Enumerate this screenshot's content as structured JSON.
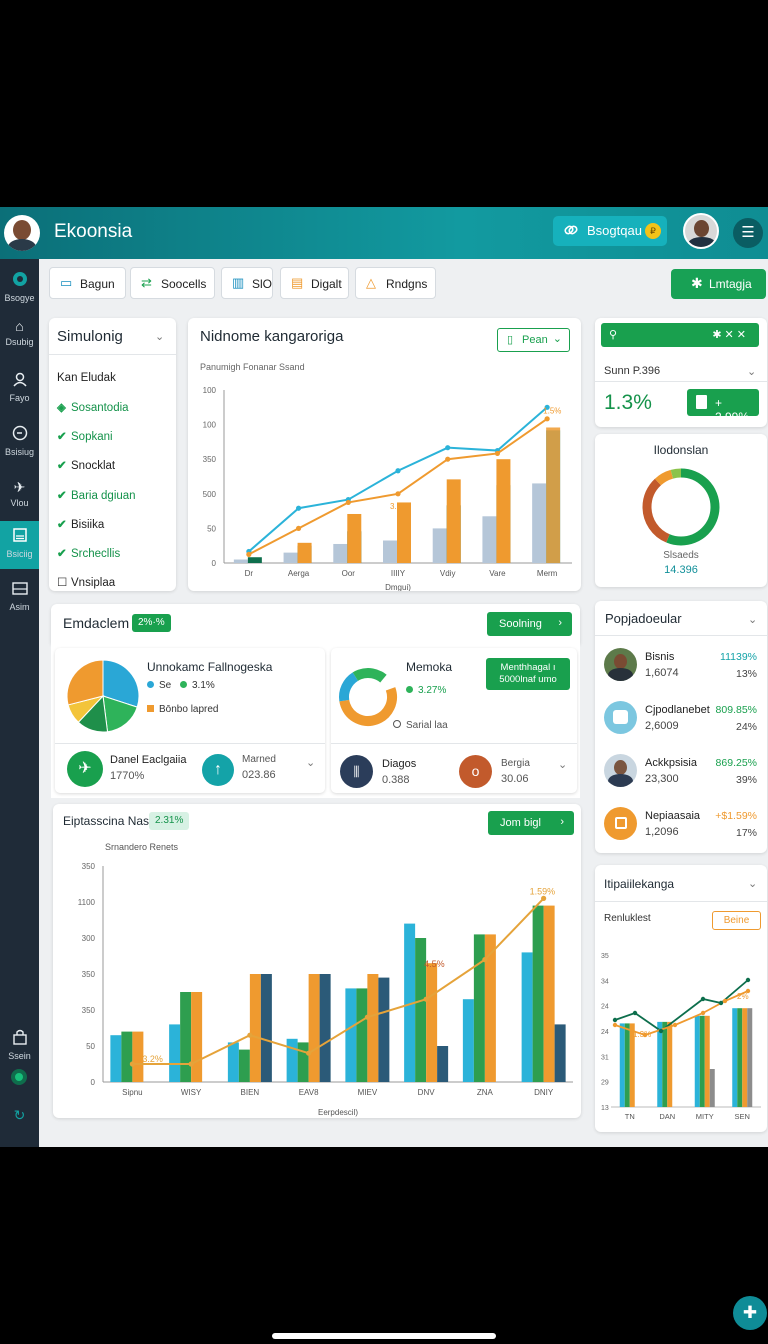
{
  "app": {
    "title": "Ekoonsia"
  },
  "header": {
    "badge_label": "Bsogtqau",
    "coin": "₽",
    "menu_icon": "menu-icon"
  },
  "colors": {
    "primary": "#19a04e",
    "teal": "#129aa0",
    "sidebar": "#1f2b38",
    "orange": "#ef9a2f",
    "blue": "#2bb3d9"
  },
  "sidebar": {
    "items": [
      {
        "label": "Bsogye",
        "icon": "logo-icon"
      },
      {
        "label": "Dsubig",
        "icon": "home-icon"
      },
      {
        "label": "Fayo",
        "icon": "user-icon"
      },
      {
        "label": "Bsisiug",
        "icon": "clock-icon"
      },
      {
        "label": "Vlou",
        "icon": "plane-icon"
      },
      {
        "label": "Bsiciig",
        "icon": "report-icon"
      },
      {
        "label": "Asim",
        "icon": "window-icon"
      }
    ],
    "bottom_item": {
      "label": "Ssein",
      "icon": "lock-icon"
    }
  },
  "toolbar": {
    "buttons": [
      {
        "label": "Bagun"
      },
      {
        "label": "Soocells"
      },
      {
        "label": "SlO"
      },
      {
        "label": "Digalt"
      },
      {
        "label": "Rndgns"
      }
    ],
    "primary_label": "Lmtagja"
  },
  "filters": {
    "title": "Simulonig",
    "heading": "Kan Eludak",
    "items": [
      {
        "label": "Sosantodia",
        "checked": true,
        "green": true
      },
      {
        "label": "Sopkani",
        "checked": true,
        "green": true
      },
      {
        "label": "Snocklat",
        "checked": true,
        "green": false
      },
      {
        "label": "Baria dgiuan",
        "checked": true,
        "green": true
      },
      {
        "label": "Bisiika",
        "checked": true,
        "green": false
      },
      {
        "label": "Srchecllis",
        "checked": true,
        "green": true
      },
      {
        "label": "Vnsiplaa",
        "checked": false,
        "green": false
      }
    ]
  },
  "main_chart": {
    "title": "Nidnome kangaroriga",
    "subtitle": "Panumigh  Fonanar Ssand",
    "period_label": "Pean"
  },
  "summary": {
    "label": "Sunn P.396",
    "value": "1.3%",
    "badge": "+ 2.99%"
  },
  "donut": {
    "title": "Ilodonslan",
    "label": "Slsaeds",
    "value": "14.396"
  },
  "section": {
    "title": "Emdaclem",
    "pill": "2%·%",
    "button_label": "Soolning"
  },
  "pie_card": {
    "title": "Unnokamc Fallnogeska",
    "legend": [
      {
        "label": "Se",
        "color": "#2aa7d6"
      },
      {
        "label": "3.1%",
        "color": "#2eb35a"
      },
      {
        "label": "Bōnbo lapred",
        "color": "#ef9a2f"
      }
    ],
    "metrics": [
      {
        "label": "Danel Eaclgaiia",
        "value": "1770%",
        "icon": "plane-icon",
        "color": "#19a04e"
      },
      {
        "label": "Marned",
        "value": "023.86",
        "icon": "arrow-up-icon",
        "color": "#14a3a8"
      }
    ]
  },
  "donut2_card": {
    "title": "Memoka",
    "legend_value": "3.27%",
    "tag": "Menthhagal ı 5000lnaf umo",
    "footnote": "Sarial laa",
    "metrics": [
      {
        "label": "Diagos",
        "value": "0.388",
        "icon": "bars-icon",
        "color": "#2b3d5a"
      },
      {
        "label": "Bergia",
        "value": "30.06",
        "icon": "circle-icon",
        "color": "#c25a2c"
      }
    ]
  },
  "bottom_chart": {
    "title": "Eiptasscina Nas",
    "pill": "2.31%",
    "button_label": "Jom bigl",
    "subtitle": "Srnandero Renets"
  },
  "people": {
    "title": "Popjadoeular",
    "items": [
      {
        "name": "Bisnis",
        "sub": "1,6074",
        "pct": "11139%",
        "pct2": "13%",
        "pct_color": "#14a3a8"
      },
      {
        "name": "Cjpodlanebet",
        "sub": "2,6009",
        "pct": "809.85%",
        "pct2": "24%",
        "pct_color": "#19a04e"
      },
      {
        "name": "Ackkpsisia",
        "sub": "23,300",
        "pct": "869.25%",
        "pct2": "39%",
        "pct_color": "#19a04e"
      },
      {
        "name": "Nepiaasaia",
        "sub": "1,2096",
        "pct": "+$1.59%",
        "pct2": "17%",
        "pct_color": "#ef9a2f"
      }
    ]
  },
  "small_chart": {
    "title": "Itipaiilekanga",
    "subtitle": "Renluklest",
    "button_label": "Beine"
  },
  "chart_data": [
    {
      "type": "bar",
      "title": "Nidnome kangaroriga",
      "xlabel": "Dmgui)",
      "categories": [
        "Dr",
        "Aerga",
        "Oor",
        "IIIIY",
        "Vdiy",
        "Vare",
        "Merm"
      ],
      "y_ticks": [
        "0",
        "50",
        "500",
        "350",
        "100",
        "100"
      ],
      "ylim": [
        0,
        6
      ],
      "series": [
        {
          "values": [
            0.2,
            0.6,
            1.1,
            1.3,
            2.0,
            2.7,
            4.6
          ],
          "color_light": "#b5c6d8",
          "color_dark": "#0d6e4c"
        },
        {
          "values": [
            0.0,
            0.7,
            1.7,
            2.1,
            2.9,
            3.6,
            4.7
          ],
          "color": "#ef9a2f"
        }
      ],
      "lines": [
        {
          "values": [
            0.4,
            1.9,
            2.2,
            3.2,
            4.0,
            3.9,
            5.4
          ],
          "color": "#2bb3d9"
        },
        {
          "values": [
            0.3,
            1.2,
            2.1,
            2.4,
            3.6,
            3.8,
            5.0
          ],
          "color": "#ef9a2f"
        }
      ],
      "annotations": [
        {
          "text": "1.5%"
        },
        {
          "text": "3.1%"
        }
      ]
    },
    {
      "type": "pie",
      "slices": [
        {
          "value": 30,
          "color": "#2aa7d6"
        },
        {
          "value": 18,
          "color": "#2eb35a"
        },
        {
          "value": 14,
          "color": "#1f8f4a"
        },
        {
          "value": 9,
          "color": "#f3c43a"
        },
        {
          "value": 29,
          "color": "#ef9a2f"
        }
      ]
    },
    {
      "type": "bar",
      "title": "Eiptasscina Nas",
      "xlabel": "Eerpdescil)",
      "categories": [
        "Sipnu",
        "WISY",
        "BIEN",
        "EAV8",
        "MIEV",
        "DNV",
        "ZNA",
        "DNIY"
      ],
      "y_ticks": [
        "0",
        "50",
        "350",
        "350",
        "300",
        "1100",
        "350"
      ],
      "ylim": [
        0,
        6
      ],
      "bars": [
        [
          1.3,
          1.4,
          1.4,
          0.0
        ],
        [
          1.6,
          2.5,
          2.5,
          0.0
        ],
        [
          1.1,
          0.9,
          3.0,
          3.0
        ],
        [
          1.2,
          1.1,
          3.0,
          3.0
        ],
        [
          2.6,
          2.6,
          3.0,
          2.9
        ],
        [
          4.4,
          4.0,
          3.3,
          1.0
        ],
        [
          2.3,
          4.1,
          4.1,
          0.0
        ],
        [
          3.6,
          4.9,
          4.9,
          1.6
        ]
      ],
      "bar_colors": [
        "#2bb3d9",
        "#2e9e4f",
        "#ef9a2f",
        "#2b5a78"
      ],
      "line": {
        "values": [
          0.5,
          0.5,
          1.3,
          0.8,
          1.8,
          2.3,
          3.4,
          5.1
        ],
        "color": "#e5a33a"
      },
      "annotations": [
        {
          "text": "1.59%"
        },
        {
          "text": "4.5%"
        },
        {
          "text": "3.2%"
        }
      ]
    },
    {
      "type": "bar",
      "title": "Itipaiilekanga",
      "categories": [
        "TN",
        "DAN",
        "MITY",
        "SEN"
      ],
      "y_ticks": [
        "13",
        "29",
        "31",
        "24",
        "24",
        "34",
        "35"
      ],
      "annotations": [
        {
          "text": "2%"
        },
        {
          "text": "1.3%"
        }
      ]
    }
  ]
}
